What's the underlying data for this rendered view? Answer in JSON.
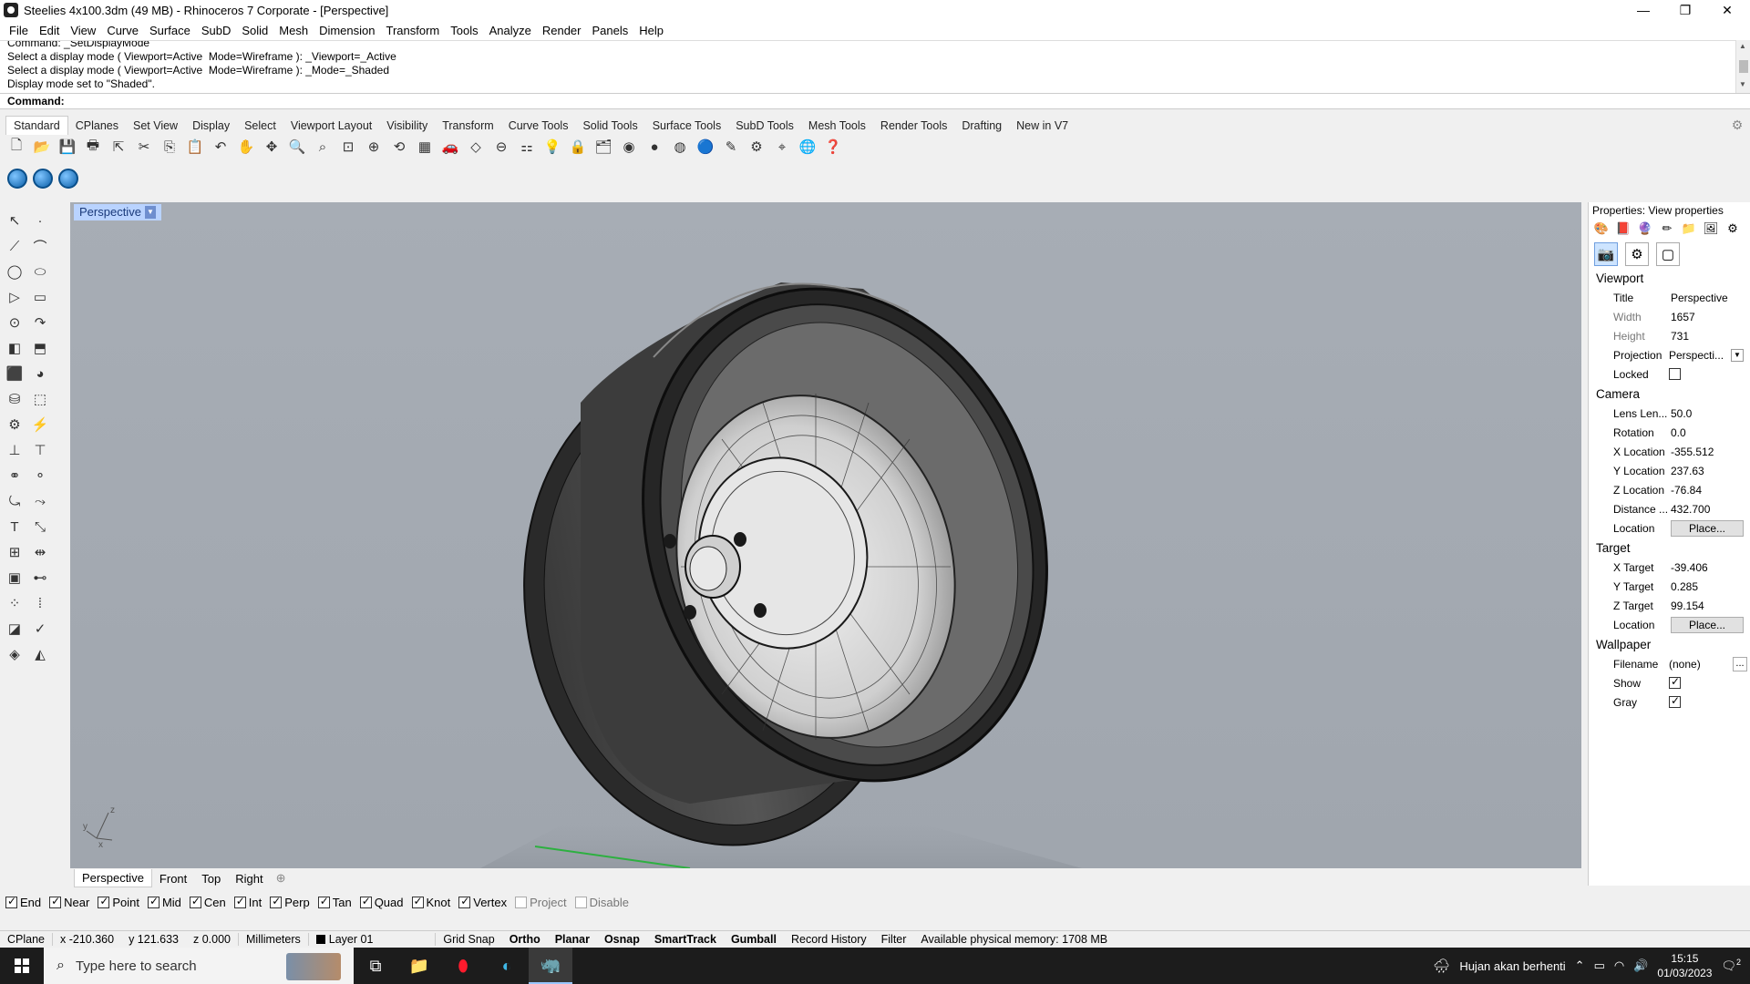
{
  "window": {
    "title": "Steelies 4x100.3dm (49 MB) - Rhinoceros 7 Corporate - [Perspective]",
    "controls": [
      "minimize-icon",
      "restore-icon",
      "close-icon"
    ]
  },
  "menu": [
    "File",
    "Edit",
    "View",
    "Curve",
    "Surface",
    "SubD",
    "Solid",
    "Mesh",
    "Dimension",
    "Transform",
    "Tools",
    "Analyze",
    "Render",
    "Panels",
    "Help"
  ],
  "command_history": [
    "Command: _SetDisplayMode",
    "Select a display mode ( Viewport=Active  Mode=Wireframe ): _Viewport=_Active",
    "Select a display mode ( Viewport=Active  Mode=Wireframe ): _Mode=_Shaded",
    "Display mode set to \"Shaded\"."
  ],
  "command_prompt": "Command:",
  "toolbar_tabs": [
    "Standard",
    "CPlanes",
    "Set View",
    "Display",
    "Select",
    "Viewport Layout",
    "Visibility",
    "Transform",
    "Curve Tools",
    "Solid Tools",
    "Surface Tools",
    "SubD Tools",
    "Mesh Tools",
    "Render Tools",
    "Drafting",
    "New in V7"
  ],
  "viewport": {
    "name": "Perspective",
    "axis_labels": {
      "z": "z",
      "y": "y",
      "x": "x"
    }
  },
  "viewport_tabs": [
    "Perspective",
    "Front",
    "Top",
    "Right"
  ],
  "osnaps": [
    {
      "label": "End",
      "checked": true
    },
    {
      "label": "Near",
      "checked": true
    },
    {
      "label": "Point",
      "checked": true
    },
    {
      "label": "Mid",
      "checked": true
    },
    {
      "label": "Cen",
      "checked": true
    },
    {
      "label": "Int",
      "checked": true
    },
    {
      "label": "Perp",
      "checked": true
    },
    {
      "label": "Tan",
      "checked": true
    },
    {
      "label": "Quad",
      "checked": true
    },
    {
      "label": "Knot",
      "checked": true
    },
    {
      "label": "Vertex",
      "checked": true
    },
    {
      "label": "Project",
      "checked": false
    },
    {
      "label": "Disable",
      "checked": false
    }
  ],
  "status": {
    "cplane": "CPlane",
    "x": "x -210.360",
    "y": "y 121.633",
    "z": "z 0.000",
    "units": "Millimeters",
    "layer": "Layer 01",
    "grid_snap": "Grid Snap",
    "ortho": "Ortho",
    "planar": "Planar",
    "osnap": "Osnap",
    "smarttrack": "SmartTrack",
    "gumball": "Gumball",
    "record_history": "Record History",
    "filter": "Filter",
    "memory": "Available physical memory: 1708 MB"
  },
  "properties": {
    "header": "Properties: View properties",
    "viewport_section": "Viewport",
    "title_label": "Title",
    "title_value": "Perspective",
    "width_label": "Width",
    "width_value": "1657",
    "height_label": "Height",
    "height_value": "731",
    "projection_label": "Projection",
    "projection_value": "Perspecti...",
    "locked_label": "Locked",
    "camera_section": "Camera",
    "lens_label": "Lens Len...",
    "lens_value": "50.0",
    "rotation_label": "Rotation",
    "rotation_value": "0.0",
    "xloc_label": "X Location",
    "xloc_value": "-355.512",
    "yloc_label": "Y Location",
    "yloc_value": "237.63",
    "zloc_label": "Z Location",
    "zloc_value": "-76.84",
    "distance_label": "Distance ...",
    "distance_value": "432.700",
    "location_label": "Location",
    "place_label": "Place...",
    "target_section": "Target",
    "xt_label": "X Target",
    "xt_value": "-39.406",
    "yt_label": "Y Target",
    "yt_value": "0.285",
    "zt_label": "Z Target",
    "zt_value": "99.154",
    "tlocation_label": "Location",
    "tplace_label": "Place...",
    "wallpaper_section": "Wallpaper",
    "filename_label": "Filename",
    "filename_value": "(none)",
    "browse_label": "...",
    "show_label": "Show",
    "gray_label": "Gray"
  },
  "taskbar": {
    "search_placeholder": "Type here to search",
    "weather": "Hujan akan berhenti",
    "time": "15:15",
    "date": "01/03/2023",
    "notification_count": "2"
  }
}
